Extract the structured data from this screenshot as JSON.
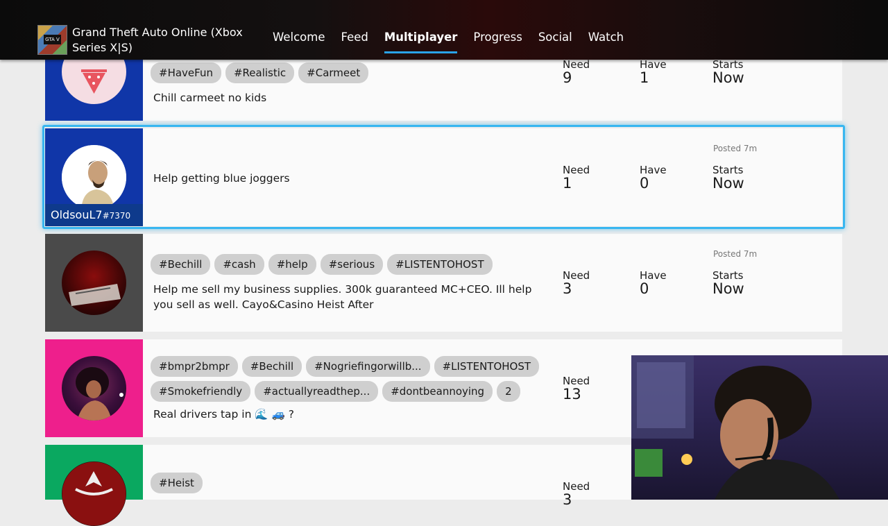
{
  "header": {
    "game_title": "Grand Theft Auto Online (Xbox Series X|S)",
    "game_tile_text": "GTA V",
    "nav": [
      "Welcome",
      "Feed",
      "Multiplayer",
      "Progress",
      "Social",
      "Watch"
    ],
    "active_tab": "Multiplayer"
  },
  "labels": {
    "need": "Need",
    "have": "Have",
    "starts": "Starts"
  },
  "posts": [
    {
      "tags": [
        "#HaveFun",
        "#Realistic",
        "#Carmeet"
      ],
      "description": "Chill carmeet no kids",
      "need": "9",
      "have": "1",
      "starts": "Now",
      "avatar_color": "#1036a8"
    },
    {
      "gamertag": "OldsouL7",
      "gamertag_suffix": "#7370",
      "description": "Help getting blue joggers",
      "posted": "Posted 7m",
      "need": "1",
      "have": "0",
      "starts": "Now",
      "avatar_color": "#1036a8",
      "selected": true
    },
    {
      "tags": [
        "#Bechill",
        "#cash",
        "#help",
        "#serious",
        "#LISTENTOHOST"
      ],
      "description_lines": [
        "Help me sell my business supplies. 300k guaranteed MC+CEO. Ill help",
        "you sell as well. Cayo&Casino Heist After"
      ],
      "posted": "Posted 7m",
      "need": "3",
      "have": "0",
      "starts": "Now",
      "avatar_color": "#4a4a4a"
    },
    {
      "tags_line1": [
        "#bmpr2bmpr",
        "#Bechill",
        "#Nogriefingorwillb...",
        "#LISTENTOHOST"
      ],
      "tags_line2": [
        "#Smokefriendly",
        "#actuallyreadthep...",
        "#dontbeannoying",
        "2"
      ],
      "description": "Real drivers tap in 🌊 🚙 ?",
      "need": "13",
      "avatar_color": "#ee1f8c"
    },
    {
      "tags": [
        "#Heist"
      ],
      "need": "3",
      "avatar_color": "#0aa860"
    }
  ]
}
